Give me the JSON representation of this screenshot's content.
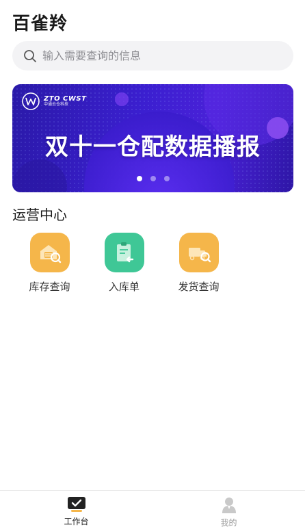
{
  "header": {
    "title": "百雀羚"
  },
  "search": {
    "placeholder": "输入需要查询的信息"
  },
  "banner": {
    "logo_brand": "ZTO CWST",
    "logo_sub": "中通云仓科技",
    "headline": "双十一仓配数据播报",
    "slide_count": 3,
    "active_slide": 1
  },
  "operations": {
    "title": "运营中心",
    "items": [
      {
        "label": "库存查询",
        "icon": "warehouse-search-icon",
        "color": "#f5b64a"
      },
      {
        "label": "入库单",
        "icon": "inbound-clipboard-icon",
        "color": "#3fc796"
      },
      {
        "label": "发货查询",
        "icon": "truck-search-icon",
        "color": "#f5b64a"
      }
    ]
  },
  "tabbar": {
    "items": [
      {
        "label": "工作台",
        "icon": "workbench-icon",
        "active": true
      },
      {
        "label": "我的",
        "icon": "profile-icon",
        "active": false
      }
    ]
  },
  "colors": {
    "accent": "#f5b64a",
    "green": "#3fc796",
    "banner_blue": "#3b1fd0"
  }
}
